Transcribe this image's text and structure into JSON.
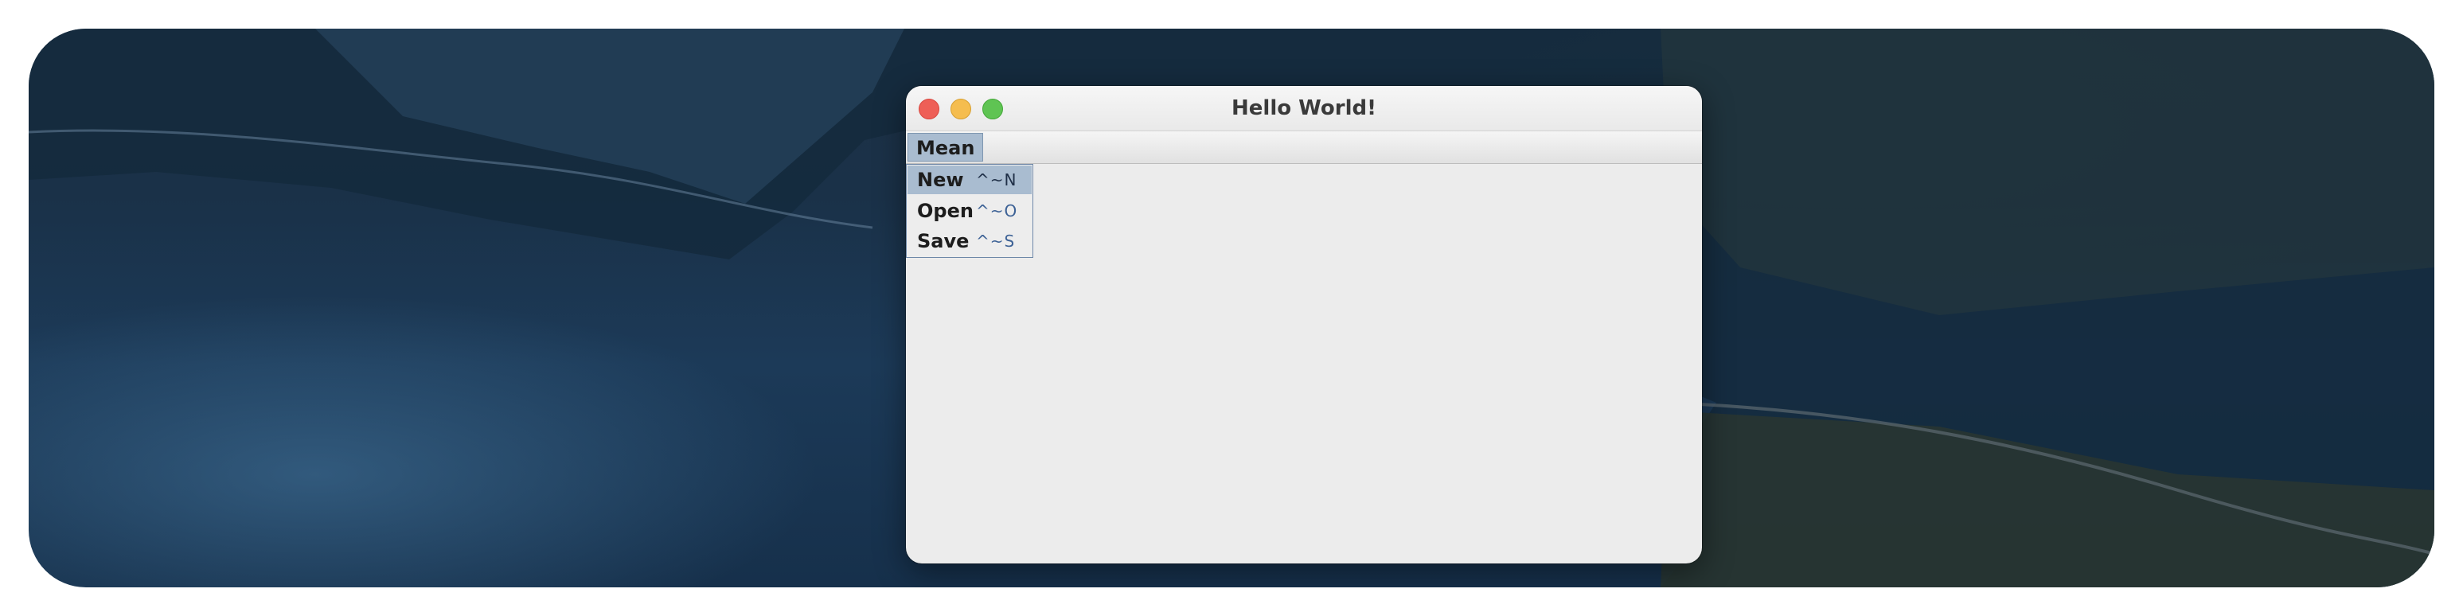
{
  "window": {
    "title": "Hello World!"
  },
  "menubar": {
    "menus": [
      {
        "label": "Mean"
      }
    ]
  },
  "dropdown": {
    "items": [
      {
        "label": "New",
        "shortcut": "^~N",
        "selected": true
      },
      {
        "label": "Open",
        "shortcut": "^~O",
        "selected": false
      },
      {
        "label": "Save",
        "shortcut": "^~S",
        "selected": false
      }
    ]
  },
  "colors": {
    "close": "#ee5f57",
    "minimize": "#f5bd4f",
    "maximize": "#5fc453",
    "menu_highlight": "#a9bcd0",
    "shortcut_text": "#3d6296"
  }
}
